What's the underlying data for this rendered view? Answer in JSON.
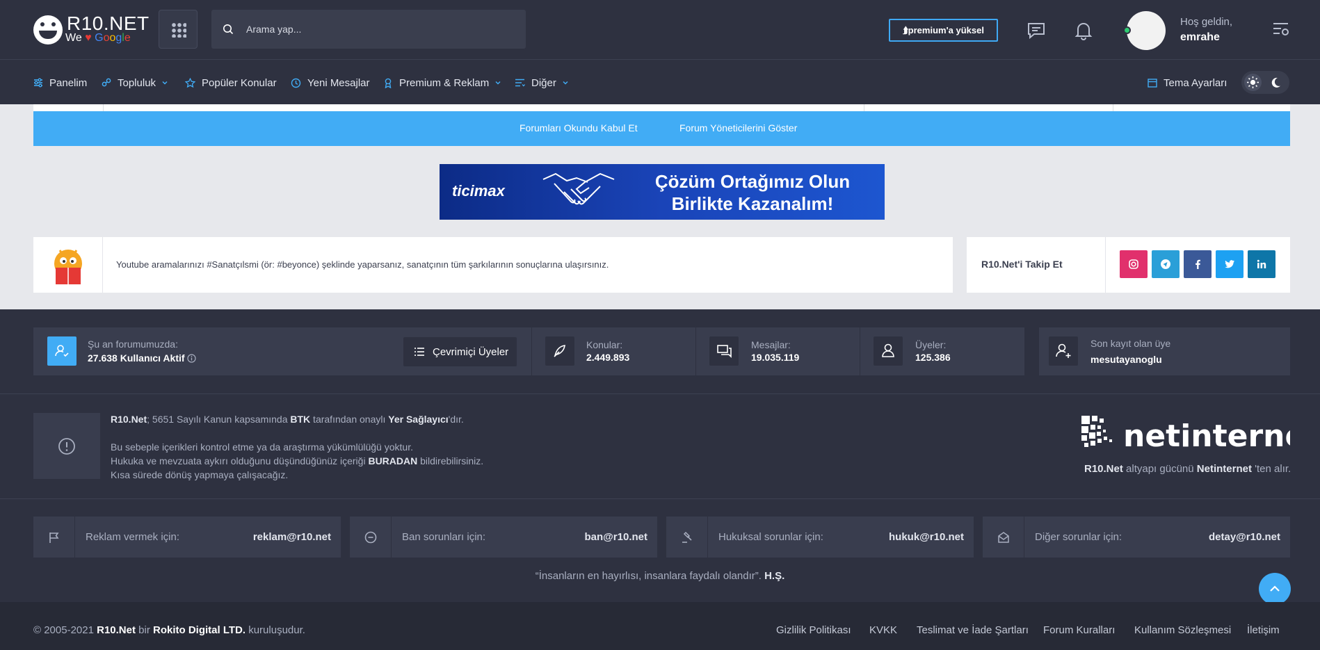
{
  "header": {
    "logo_name": "R10.NET",
    "logo_tag_pre": "We",
    "logo_tag_heart": "♥",
    "logo_tag_google": [
      "G",
      "o",
      "o",
      "g",
      "l",
      "e"
    ],
    "search_placeholder": "Arama yap...",
    "premium_label": "⮭premium'a yüksel",
    "welcome": "Hoş geldin,",
    "username": "emrahe",
    "icons": [
      "apps-grid-icon",
      "search-icon",
      "chat-icon",
      "bell-icon",
      "settings-menu-icon"
    ]
  },
  "nav": {
    "items": [
      {
        "label": "Panelim",
        "icon": "sliders-icon",
        "dropdown": false
      },
      {
        "label": "Topluluk",
        "icon": "community-icon",
        "dropdown": true
      },
      {
        "label": "Popüler Konular",
        "icon": "star-icon",
        "dropdown": false
      },
      {
        "label": "Yeni Mesajlar",
        "icon": "clock-icon",
        "dropdown": false
      },
      {
        "label": "Premium & Reklam",
        "icon": "award-icon",
        "dropdown": true
      },
      {
        "label": "Diğer",
        "icon": "list-icon",
        "dropdown": true
      }
    ],
    "theme_label": "Tema Ayarları"
  },
  "actions": {
    "mark_read": "Forumları Okundu Kabul Et",
    "show_mods": "Forum Yöneticilerini Göster"
  },
  "banner": {
    "brand": "ticimax",
    "line1": "Çözüm Ortağımız Olun",
    "line2": "Birlikte Kazanalım!"
  },
  "tip": {
    "text": "Youtube aramalarınızı #Sanatçılsmi (ör: #beyonce) şeklinde yaparsanız, sanatçının tüm şarkılarının sonuçlarına ulaşırsınız."
  },
  "follow": {
    "label": "R10.Net'i Takip Et",
    "social": [
      {
        "name": "instagram",
        "color": "#e1306c"
      },
      {
        "name": "telegram",
        "color": "#2a9fd8"
      },
      {
        "name": "facebook",
        "color": "#3b5998"
      },
      {
        "name": "twitter",
        "color": "#1da1f2"
      },
      {
        "name": "linkedin",
        "color": "#0e76a8"
      }
    ]
  },
  "stats": {
    "online_label": "Şu an forumumuzda:",
    "online_value": "27.638 Kullanıcı Aktif",
    "online_button": "Çevrimiçi Üyeler",
    "topics_label": "Konular:",
    "topics_value": "2.449.893",
    "messages_label": "Mesajlar:",
    "messages_value": "19.035.119",
    "members_label": "Üyeler:",
    "members_value": "125.386",
    "latest_label": "Son kayıt olan üye",
    "latest_value": "mesutayanoglu"
  },
  "legal": {
    "l1_brand": "R10.Net",
    "l1_a": "; 5651 Sayılı Kanun kapsamında ",
    "l1_btk": "BTK",
    "l1_b": " tarafından onaylı ",
    "l1_provider": "Yer Sağlayıcı",
    "l1_c": "'dır.",
    "l2": "Bu sebeple içerikleri kontrol etme ya da araştırma yükümlülüğü yoktur.",
    "l3_a": "Hukuka ve mevzuata aykırı olduğunu düşündüğünüz içeriği ",
    "l3_link": "BURADAN",
    "l3_b": " bildirebilirsiniz.",
    "l4": "Kısa sürede dönüş yapmaya çalışacağız.",
    "net_logo": "netinternet",
    "net_cap_brand": "R10.Net",
    "net_cap_a": " altyapı gücünü ",
    "net_cap_net": "Netinternet",
    "net_cap_b": " 'ten alır."
  },
  "contacts": [
    {
      "label": "Reklam vermek için:",
      "email": "reklam@r10.net",
      "icon": "flag-icon"
    },
    {
      "label": "Ban sorunları için:",
      "email": "ban@r10.net",
      "icon": "minus-circle-icon"
    },
    {
      "label": "Hukuksal sorunlar için:",
      "email": "hukuk@r10.net",
      "icon": "gavel-icon"
    },
    {
      "label": "Diğer sorunlar için:",
      "email": "detay@r10.net",
      "icon": "mail-open-icon"
    }
  ],
  "quote": {
    "text": "“İnsanların en hayırlısı, insanlara faydalı olandır”. ",
    "author": "H.Ş."
  },
  "footer": {
    "copy_a": "© 2005-2021 ",
    "copy_brand": "R10.Net",
    "copy_b": " bir ",
    "copy_company": "Rokito Digital LTD.",
    "copy_c": " kuruluşudur.",
    "links": [
      "Gizlilik Politikası",
      "KVKK",
      "Teslimat ve İade Şartları",
      "Forum Kuralları",
      "Kullanım Sözleşmesi",
      "İletişim"
    ]
  },
  "colors": {
    "accent": "#41acf5",
    "header_bg": "#2e3140",
    "panel_bg": "#393d4e",
    "footer_bg": "#272a36",
    "light_bg": "#e7e8ec"
  }
}
